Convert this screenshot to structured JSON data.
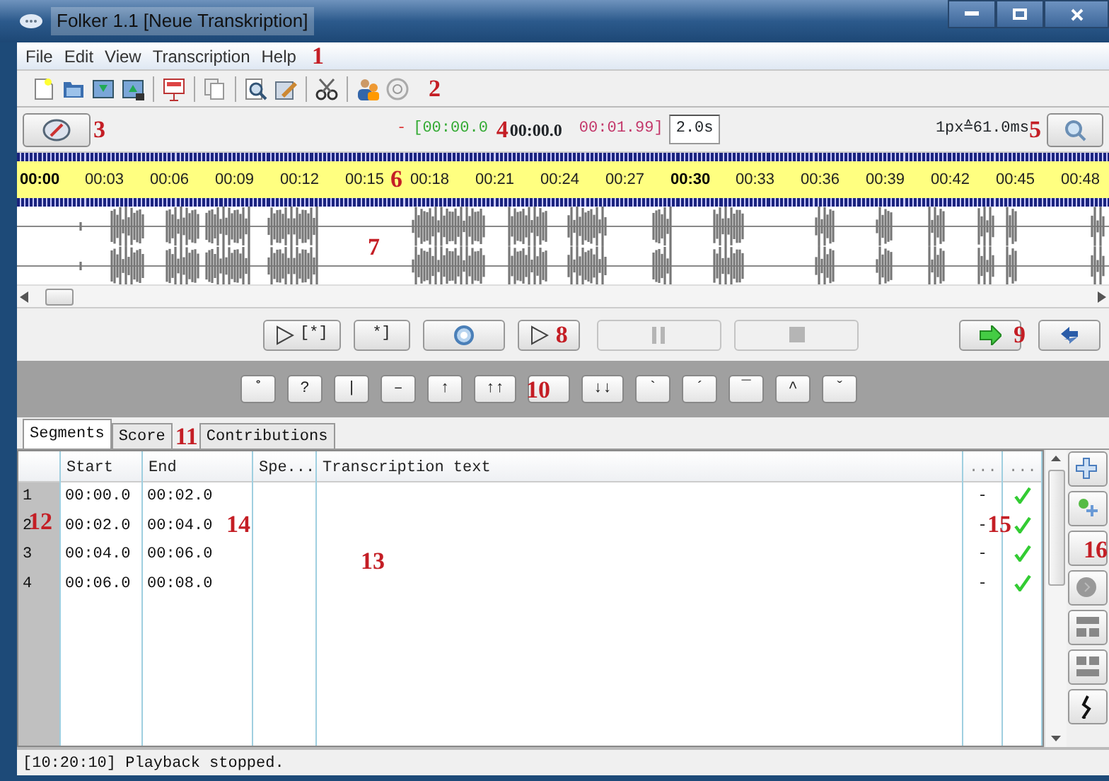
{
  "window": {
    "title": "Folker 1.1 [Neue Transkription]"
  },
  "menu": {
    "items": [
      "File",
      "Edit",
      "View",
      "Transcription",
      "Help"
    ],
    "callout": "1"
  },
  "toolbar": {
    "callout": "2"
  },
  "position_bar": {
    "callout_button": "3",
    "marker": "-",
    "start": "[00:00.0",
    "callout_time": "4",
    "current": "00:00.0",
    "end": "00:01.99]",
    "duration": "2.0s",
    "scale": "1px≙61.0ms",
    "callout_scale": "5"
  },
  "timeline": {
    "ticks": [
      {
        "label": "00:00",
        "major": true
      },
      {
        "label": "00:03",
        "major": false
      },
      {
        "label": "00:06",
        "major": false
      },
      {
        "label": "00:09",
        "major": false
      },
      {
        "label": "00:12",
        "major": false
      },
      {
        "label": "00:15",
        "major": false
      },
      {
        "label": "00:18",
        "major": false
      },
      {
        "label": "00:21",
        "major": false
      },
      {
        "label": "00:24",
        "major": false
      },
      {
        "label": "00:27",
        "major": false
      },
      {
        "label": "00:30",
        "major": true
      },
      {
        "label": "00:33",
        "major": false
      },
      {
        "label": "00:36",
        "major": false
      },
      {
        "label": "00:39",
        "major": false
      },
      {
        "label": "00:42",
        "major": false
      },
      {
        "label": "00:45",
        "major": false
      },
      {
        "label": "00:48",
        "major": false
      }
    ],
    "callout_ruler": "6",
    "callout_wave": "7"
  },
  "playback": {
    "buttons": [
      {
        "kind": "play",
        "label": "[*]",
        "disabled": false
      },
      {
        "kind": "text",
        "label": "*]",
        "disabled": false
      },
      {
        "kind": "loop",
        "disabled": false
      },
      {
        "kind": "play",
        "disabled": false
      },
      {
        "kind": "pause",
        "disabled": true
      },
      {
        "kind": "stop",
        "disabled": true
      }
    ],
    "callout": "8",
    "nav": [
      {
        "kind": "forward"
      },
      {
        "kind": "sync"
      }
    ],
    "callout_nav": "9"
  },
  "symbols": {
    "buttons": [
      {
        "label": "˚"
      },
      {
        "label": "?"
      },
      {
        "label": "|"
      },
      {
        "label": "–"
      },
      {
        "label": "↑"
      },
      {
        "label": "↑↑"
      },
      {
        "callout": "10"
      },
      {
        "label": "↓↓"
      },
      {
        "label": "`"
      },
      {
        "label": "´"
      },
      {
        "label": "¯"
      },
      {
        "label": "^"
      },
      {
        "label": "ˇ"
      }
    ]
  },
  "tabs": {
    "items": [
      {
        "label": "Segments",
        "selected": true
      },
      {
        "label": "Score",
        "selected": false
      },
      {
        "label": "Contributions",
        "selected": false
      }
    ],
    "callout": "11"
  },
  "table": {
    "columns": [
      "Start",
      "End",
      "Spe...",
      "Transcription text",
      "...",
      "..."
    ],
    "rows": [
      {
        "number": "1",
        "start": "00:00.0",
        "end": "00:02.0",
        "column_6": "-",
        "checked": true
      },
      {
        "number": "2",
        "start": "00:02.0",
        "end": "00:04.0",
        "column_6": "-",
        "checked": true
      },
      {
        "number": "3",
        "start": "00:04.0",
        "end": "00:06.0",
        "column_6": "-",
        "checked": true
      },
      {
        "number": "4",
        "start": "00:06.0",
        "end": "00:08.0",
        "column_6": "-",
        "checked": true
      }
    ],
    "callout_number": "12",
    "callout_text": "13",
    "callout_end": "14",
    "callout_status": "15"
  },
  "side_toolbar": {
    "callout": "16"
  },
  "status_bar": "[10:20:10] Playback stopped."
}
